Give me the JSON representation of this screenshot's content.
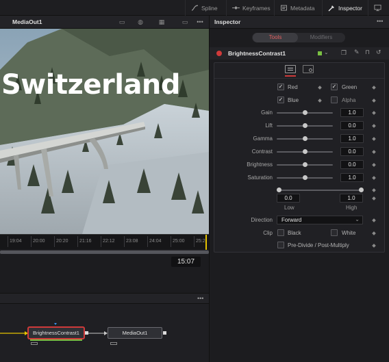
{
  "top_tabs": [
    {
      "label": "Spline",
      "icon": "spline-icon"
    },
    {
      "label": "Keyframes",
      "icon": "keyframes-icon"
    },
    {
      "label": "Metadata",
      "icon": "metadata-icon"
    },
    {
      "label": "Inspector",
      "icon": "inspector-icon",
      "active": true
    }
  ],
  "viewer": {
    "title": "MediaOut1",
    "overlay_text": "Switzerland",
    "timeline_labels": [
      "19:04",
      "20:00",
      "20:20",
      "21:16",
      "22:12",
      "23:08",
      "24:04",
      "25:00",
      "25:2"
    ],
    "timecode": "15:07",
    "more": "•••"
  },
  "inspector": {
    "title": "Inspector",
    "more": "•••",
    "tabs": {
      "tools": "Tools",
      "modifiers": "Modifiers"
    },
    "node_name": "BrightnessContrast1",
    "checks": {
      "red": {
        "label": "Red",
        "checked": true
      },
      "green": {
        "label": "Green",
        "checked": true
      },
      "blue": {
        "label": "Blue",
        "checked": true
      },
      "alpha": {
        "label": "Alpha",
        "checked": false
      }
    },
    "params": [
      {
        "label": "Gain",
        "value": "1.0",
        "knob": 0.5
      },
      {
        "label": "Lift",
        "value": "0.0",
        "knob": 0.5
      },
      {
        "label": "Gamma",
        "value": "1.0",
        "knob": 0.5
      },
      {
        "label": "Contrast",
        "value": "0.0",
        "knob": 0.5
      },
      {
        "label": "Brightness",
        "value": "0.0",
        "knob": 0.5
      },
      {
        "label": "Saturation",
        "value": "1.0",
        "knob": 0.5
      }
    ],
    "range": {
      "low_value": "0.0",
      "high_value": "1.0",
      "low_label": "Low",
      "high_label": "High"
    },
    "direction": {
      "label": "Direction",
      "value": "Forward"
    },
    "clip": {
      "label": "Clip",
      "black": "Black",
      "white": "White"
    },
    "predivide": "Pre-Divide / Post-Multiply"
  },
  "nodes": {
    "more": "•••",
    "brightness": "BrightnessContrast1",
    "mediaout": "MediaOut1"
  },
  "colors": {
    "accent_red": "#d03a3a",
    "check_green": "#7ac043",
    "link_yellow": "#e6c400"
  }
}
